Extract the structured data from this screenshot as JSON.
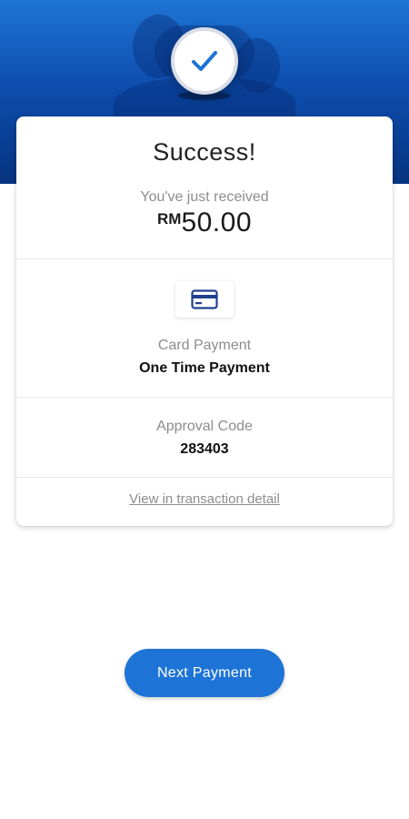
{
  "colors": {
    "accent": "#1e74d6",
    "header_top": "#1f74d4",
    "header_bottom": "#06337f",
    "card_icon": "#1f3f8f"
  },
  "icons": {
    "status": "check-icon",
    "payment_method": "credit-card-icon"
  },
  "result": {
    "title": "Success!",
    "received_label": "You've just received",
    "currency": "RM",
    "amount": "50.00"
  },
  "payment": {
    "type_label": "Card Payment",
    "name": "One Time Payment"
  },
  "approval": {
    "label": "Approval Code",
    "code": "283403"
  },
  "links": {
    "transaction_detail": "View in transaction detail"
  },
  "actions": {
    "next_payment": "Next Payment"
  }
}
